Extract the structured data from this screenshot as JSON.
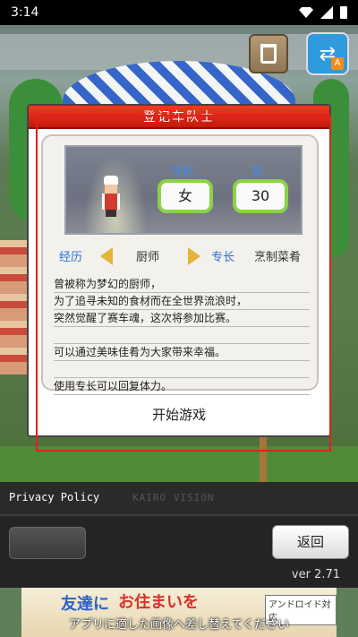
{
  "status_bar": {
    "time": "3:14"
  },
  "dialog": {
    "title": "登记车队士",
    "gender_label": "性别",
    "gender_value": "女",
    "age_label": "脸",
    "age_value": "30",
    "career_label": "经历",
    "career_value": "厨师",
    "skill_label": "专长",
    "skill_value": "烹制菜肴",
    "description_lines": [
      "曾被称为梦幻的厨师，",
      "为了追寻未知的食材而在全世界流浪时，",
      "突然觉醒了赛车魂，这次将参加比赛。",
      "",
      "可以通过美味佳肴为大家带来幸福。",
      "",
      "使用专长可以回复体力。"
    ],
    "start_button": "开始游戏"
  },
  "footer": {
    "privacy": "Privacy Policy",
    "brand": "KAIRO VISION",
    "back_button": "返回",
    "version": "ver 2.71"
  },
  "ad": {
    "text_blue": "友達に",
    "text_red": "お住まいを",
    "badge": "アンドロイド対応",
    "overlay": "アプリに適した画像へ差し替えてください"
  },
  "icons": {
    "trash": "trash-icon",
    "switch_account": "account-switch-icon"
  },
  "colors": {
    "title_bar": "#e0281a",
    "field_border": "#8bd248",
    "label_blue": "#2c6ed6"
  }
}
